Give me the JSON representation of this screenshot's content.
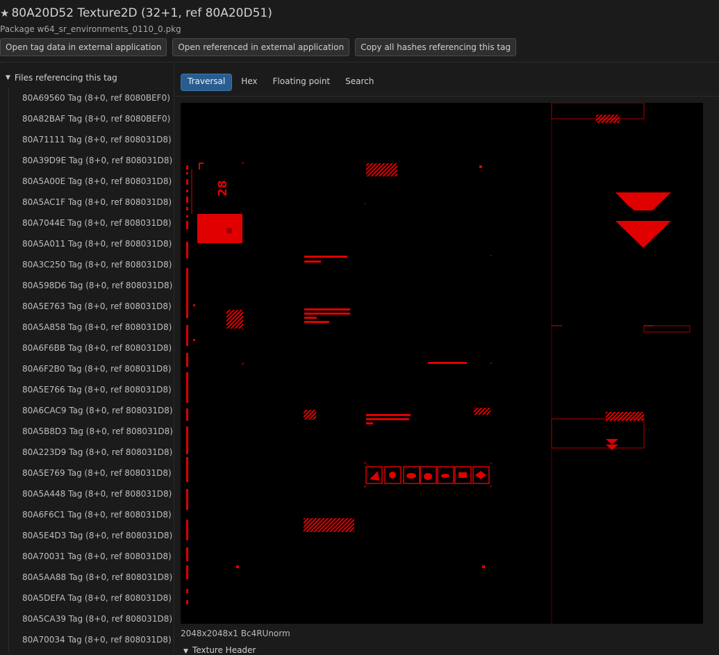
{
  "header": {
    "title": "80A20D52 Texture2D (32+1, ref 80A20D51)",
    "star_icon": "star-icon",
    "package": "Package w64_sr_environments_0110_0.pkg",
    "buttons": [
      "Open tag data in external application",
      "Open referenced in external application",
      "Copy all hashes referencing this tag"
    ]
  },
  "sidebar": {
    "heading": "Files referencing this tag",
    "items": [
      "80A69560 Tag (8+0, ref 8080BEF0)",
      "80A82BAF Tag (8+0, ref 8080BEF0)",
      "80A71111 Tag (8+0, ref 808031D8)",
      "80A39D9E Tag (8+0, ref 808031D8)",
      "80A5A00E Tag (8+0, ref 808031D8)",
      "80A5AC1F Tag (8+0, ref 808031D8)",
      "80A7044E Tag (8+0, ref 808031D8)",
      "80A5A011 Tag (8+0, ref 808031D8)",
      "80A3C250 Tag (8+0, ref 808031D8)",
      "80A598D6 Tag (8+0, ref 808031D8)",
      "80A5E763 Tag (8+0, ref 808031D8)",
      "80A5A858 Tag (8+0, ref 808031D8)",
      "80A6F6BB Tag (8+0, ref 808031D8)",
      "80A6F2B0 Tag (8+0, ref 808031D8)",
      "80A5E766 Tag (8+0, ref 808031D8)",
      "80A6CAC9 Tag (8+0, ref 808031D8)",
      "80A5B8D3 Tag (8+0, ref 808031D8)",
      "80A223D9 Tag (8+0, ref 808031D8)",
      "80A5E769 Tag (8+0, ref 808031D8)",
      "80A5A448 Tag (8+0, ref 808031D8)",
      "80A6F6C1 Tag (8+0, ref 808031D8)",
      "80A5E4D3 Tag (8+0, ref 808031D8)",
      "80A70031 Tag (8+0, ref 808031D8)",
      "80A5AA88 Tag (8+0, ref 808031D8)",
      "80A5DEFA Tag (8+0, ref 808031D8)",
      "80A5CA39 Tag (8+0, ref 808031D8)",
      "80A70034 Tag (8+0, ref 808031D8)"
    ]
  },
  "tabs": {
    "active": "Traversal",
    "items": [
      "Traversal",
      "Hex",
      "Floating point",
      "Search"
    ]
  },
  "texture": {
    "accent_color": "#e00000",
    "big_label": "28",
    "dimensions": "2048x2048x1 Bc4RUnorm"
  },
  "texture_header": "Texture Header"
}
